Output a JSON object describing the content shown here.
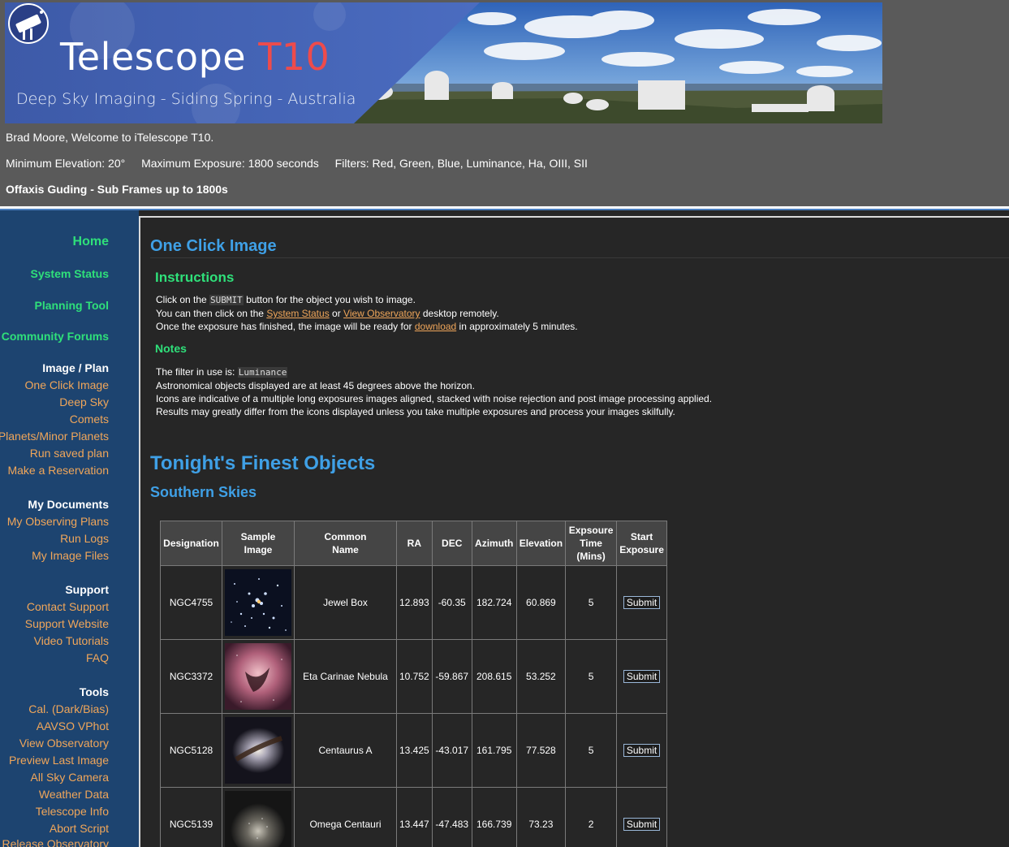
{
  "banner": {
    "title_main": "Telescope ",
    "title_accent": "T10",
    "subtitle": "Deep Sky Imaging - Siding Spring - Australia"
  },
  "header": {
    "welcome": "Brad Moore, Welcome to iTelescope T10.",
    "min_elevation": "Minimum Elevation: 20°",
    "max_exposure": "Maximum Exposure: 1800 seconds",
    "filters": "Filters: Red, Green, Blue, Luminance, Ha, OIII, SII",
    "guiding": "Offaxis Guding - Sub Frames up to 1800s"
  },
  "sidebar": {
    "home": "Home",
    "system_status": "System Status",
    "planning_tool": "Planning Tool",
    "community_forums": "Community Forums",
    "image_plan": {
      "heading": "Image / Plan",
      "items": [
        "One Click Image",
        "Deep Sky",
        "Comets",
        "Planets/Minor Planets",
        "Run saved plan",
        "Make a Reservation"
      ]
    },
    "my_documents": {
      "heading": "My Documents",
      "items": [
        "My Observing Plans",
        "Run Logs",
        "My Image Files"
      ]
    },
    "support": {
      "heading": "Support",
      "items": [
        "Contact Support",
        "Support Website",
        "Video Tutorials",
        "FAQ"
      ]
    },
    "tools": {
      "heading": "Tools",
      "items": [
        "Cal. (Dark/Bias)",
        "AAVSO VPhot",
        "View Observatory",
        "Preview Last Image",
        "All Sky Camera",
        "Weather Data",
        "Telescope Info",
        "Abort Script",
        "Release Observatory"
      ]
    }
  },
  "main": {
    "title": "One Click Image",
    "instructions_heading": "Instructions",
    "instr": {
      "l1_a": "Click on the ",
      "l1_code": "SUBMIT",
      "l1_b": " button for the object you wish to image.",
      "l2_a": "You can then click on the ",
      "l2_link1": "System Status",
      "l2_b": " or ",
      "l2_link2": "View Observatory",
      "l2_c": " desktop remotely.",
      "l3_a": "Once the exposure has finished, the image will be ready for ",
      "l3_link": "download",
      "l3_b": " in approximately 5 minutes."
    },
    "notes_heading": "Notes",
    "notes": {
      "l1_a": "The filter in use is: ",
      "l1_code": "Luminance",
      "l2": "Astronomical objects displayed are at least 45 degrees above the horizon.",
      "l3": "Icons are indicative of a multiple long exposures images aligned, stacked with noise rejection and post image processing applied.",
      "l4": "Results may greatly differ from the icons displayed unless you take multiple exposures and process your images skilfully."
    },
    "finest_heading": "Tonight's Finest Objects",
    "region_heading": "Southern Skies"
  },
  "table": {
    "headers": {
      "designation": "Designation",
      "sample_1": "Sample",
      "sample_2": "Image",
      "common_1": "Common",
      "common_2": "Name",
      "ra": "RA",
      "dec": "DEC",
      "azimuth": "Azimuth",
      "elevation": "Elevation",
      "exp_1": "Expsoure",
      "exp_2": "Time",
      "exp_3": "(Mins)",
      "start_1": "Start",
      "start_2": "Exposure"
    },
    "submit_label": "Submit",
    "rows": [
      {
        "designation": "NGC4755",
        "name": "Jewel Box",
        "ra": "12.893",
        "dec": "-60.35",
        "azimuth": "182.724",
        "elevation": "60.869",
        "time": "5"
      },
      {
        "designation": "NGC3372",
        "name": "Eta Carinae Nebula",
        "ra": "10.752",
        "dec": "-59.867",
        "azimuth": "208.615",
        "elevation": "53.252",
        "time": "5"
      },
      {
        "designation": "NGC5128",
        "name": "Centaurus A",
        "ra": "13.425",
        "dec": "-43.017",
        "azimuth": "161.795",
        "elevation": "77.528",
        "time": "5"
      },
      {
        "designation": "NGC5139",
        "name": "Omega Centauri",
        "ra": "13.447",
        "dec": "-47.483",
        "azimuth": "166.739",
        "elevation": "73.23",
        "time": "2"
      }
    ]
  },
  "colors": {
    "nav_green": "#2fe07a",
    "link_orange": "#f0a65a",
    "heading_blue": "#3fa0e6",
    "sidebar_bg": "#1d4470"
  }
}
